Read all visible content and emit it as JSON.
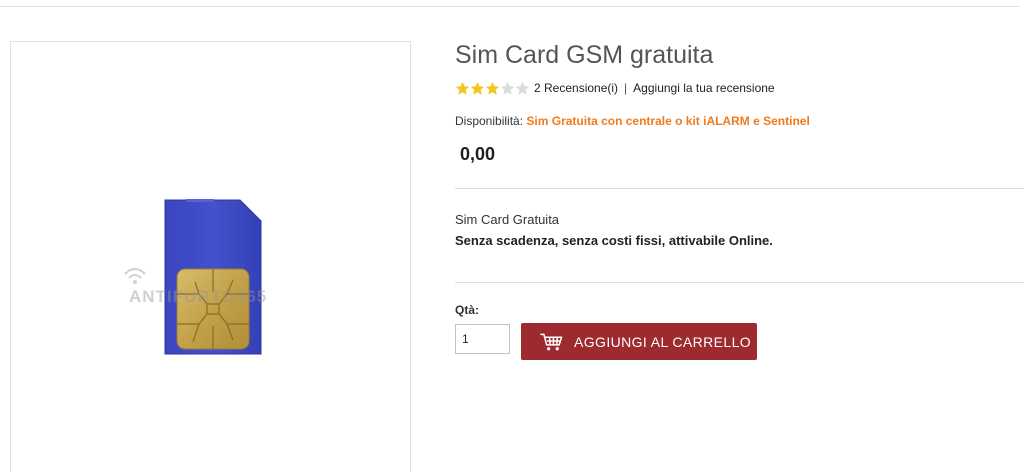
{
  "product": {
    "title": "Sim Card GSM gratuita",
    "image_watermark": "ANTIFURTO365",
    "rating": {
      "stars_filled": 3,
      "stars_total": 5,
      "reviews_link": "2 Recensione(i)",
      "separator": "|",
      "add_review_link": "Aggiungi la tua recensione"
    },
    "availability": {
      "label": "Disponibilità:",
      "value": "Sim Gratuita con centrale o kit iALARM e Sentinel"
    },
    "price": "0,00",
    "description": {
      "line1": "Sim Card Gratuita",
      "line2": "Senza scadenza, senza costi fissi, attivabile Online."
    },
    "quantity": {
      "label": "Qtà:",
      "value": "1"
    },
    "add_to_cart": {
      "label": "AGGIUNGI AL CARRELLO",
      "icon": "cart-icon"
    }
  },
  "colors": {
    "accent_orange": "#f07b1f",
    "button_red": "#9c2a2e",
    "star_gold": "#f3c623",
    "star_empty": "#dcdcdc",
    "sim_blue": "#3d49c4",
    "chip_gold": "#c9a84f"
  }
}
